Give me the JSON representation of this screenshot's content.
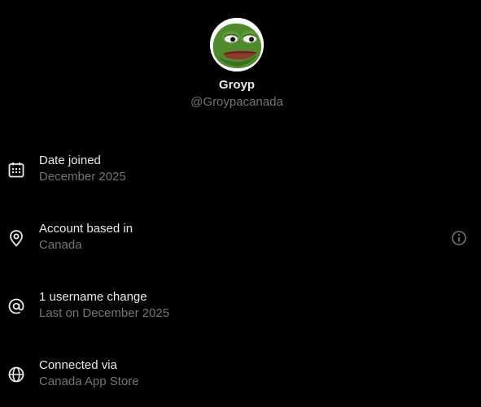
{
  "profile": {
    "display_name": "Groyp",
    "handle": "@Groypacanada"
  },
  "details": [
    {
      "icon": "calendar-icon",
      "title": "Date joined",
      "value": "December 2025"
    },
    {
      "icon": "location-pin-icon",
      "title": "Account based in",
      "value": "Canada",
      "action_icon": "info-icon"
    },
    {
      "icon": "at-sign-icon",
      "title": "1 username change",
      "value": "Last on December 2025"
    },
    {
      "icon": "globe-icon",
      "title": "Connected via",
      "value": "Canada App Store"
    }
  ],
  "colors": {
    "background": "#000000",
    "primary_text": "#e7e9ea",
    "secondary_text": "#71767b"
  }
}
